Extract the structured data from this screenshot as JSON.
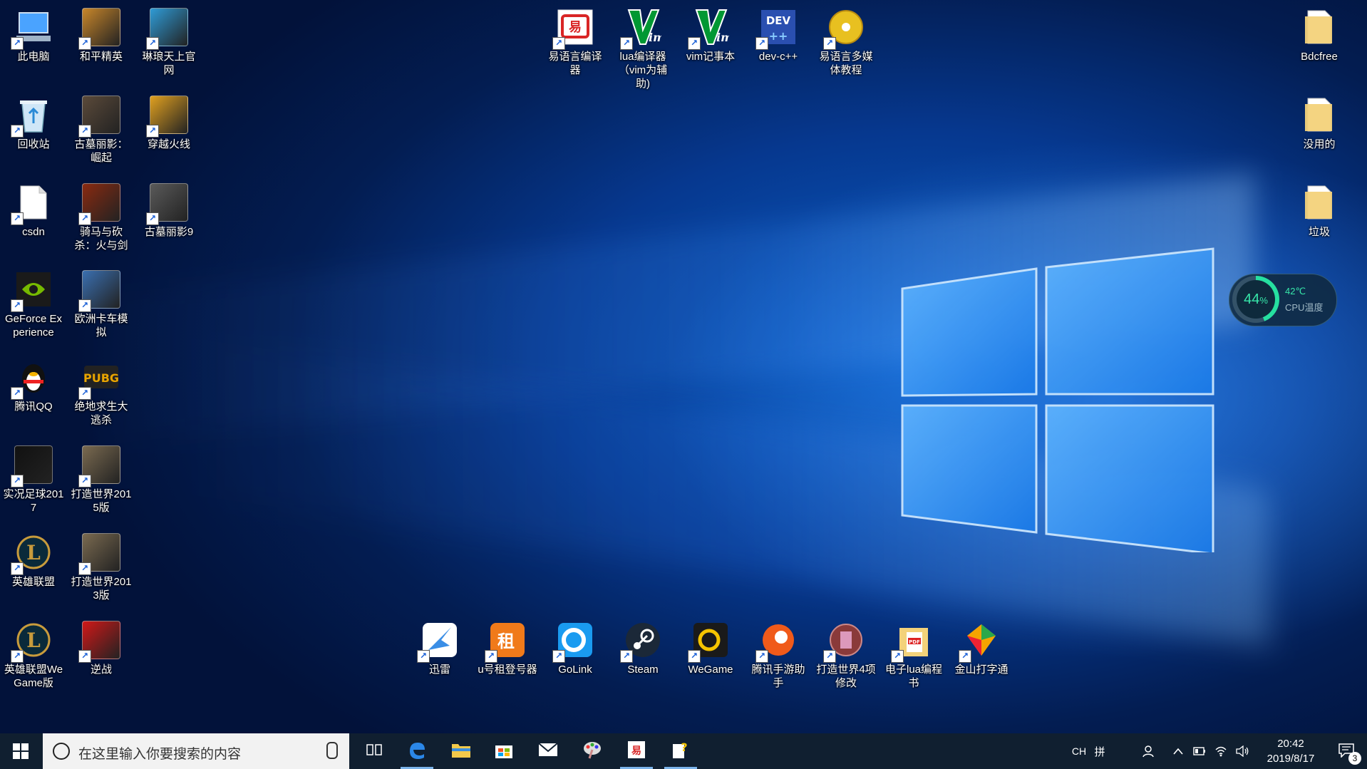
{
  "desktop": {
    "left_icons": [
      {
        "label": "此电脑",
        "icon": "computer-icon",
        "color": "#4aa3ff"
      },
      {
        "label": "和平精英",
        "icon": "game-icon",
        "color": "#c8862a"
      },
      {
        "label": "琳琅天上官网",
        "icon": "game-icon",
        "color": "#2f9bd6"
      },
      {
        "label": "回收站",
        "icon": "recycle-bin-icon",
        "color": "#cfe6f7"
      },
      {
        "label": "古墓丽影：崛起",
        "icon": "game-icon",
        "color": "#5b4a3a"
      },
      {
        "label": "穿越火线",
        "icon": "game-icon",
        "color": "#e0a020"
      },
      {
        "label": "csdn",
        "icon": "file-icon",
        "color": "#ffffff"
      },
      {
        "label": "骑马与砍杀：火与剑",
        "icon": "game-icon",
        "color": "#8a2a10"
      },
      {
        "label": "古墓丽影9",
        "icon": "game-icon",
        "color": "#5a5a5a"
      },
      {
        "label": "GeForce Experience",
        "icon": "nvidia-icon",
        "color": "#76b900"
      },
      {
        "label": "欧洲卡车模拟",
        "icon": "game-icon",
        "color": "#3a6fb0"
      },
      {
        "label": "腾讯QQ",
        "icon": "qq-penguin-icon",
        "color": "#111111"
      },
      {
        "label": "绝地求生大逃杀",
        "icon": "pubg-icon",
        "color": "#e8a400"
      },
      {
        "label": "实况足球2017",
        "icon": "game-icon",
        "color": "#111111"
      },
      {
        "label": "打造世界2015版",
        "icon": "game-icon",
        "color": "#7a6a50"
      },
      {
        "label": "英雄联盟",
        "icon": "lol-icon",
        "color": "#c89b3c"
      },
      {
        "label": "打造世界2013版",
        "icon": "game-icon",
        "color": "#7a6a50"
      },
      {
        "label": "英雄联盟WeGame版",
        "icon": "lol-icon",
        "color": "#c89b3c"
      },
      {
        "label": "逆战",
        "icon": "game-icon",
        "color": "#d01818"
      }
    ],
    "top_icons": [
      {
        "label": "易语言编译器",
        "icon": "eyuyan-icon",
        "color": "#d92525"
      },
      {
        "label": "lua编译器（vim为辅助)",
        "icon": "vim-icon",
        "color": "#019833"
      },
      {
        "label": "vim记事本",
        "icon": "vim-icon",
        "color": "#019833"
      },
      {
        "label": "dev-c++",
        "icon": "devcpp-icon",
        "color": "#2a4fb0"
      },
      {
        "label": "易语言多媒体教程",
        "icon": "cd-icon",
        "color": "#e8c020"
      }
    ],
    "right_icons": [
      {
        "label": "Bdcfree",
        "icon": "folder-icon",
        "color": "#f3d27a"
      },
      {
        "label": "没用的",
        "icon": "folder-icon",
        "color": "#f3d27a"
      },
      {
        "label": "垃圾",
        "icon": "folder-icon",
        "color": "#f3d27a"
      }
    ],
    "bottom_icons": [
      {
        "label": "迅雷",
        "icon": "xunlei-icon",
        "color": "#3a8ee6"
      },
      {
        "label": "u号租登号器",
        "icon": "uhaozu-icon",
        "color": "#f07a1a"
      },
      {
        "label": "GoLink",
        "icon": "golink-icon",
        "color": "#1a9bf0"
      },
      {
        "label": "Steam",
        "icon": "steam-icon",
        "color": "#1b2838"
      },
      {
        "label": "WeGame",
        "icon": "wegame-icon",
        "color": "#1a1a1a"
      },
      {
        "label": "腾讯手游助手",
        "icon": "tencent-mobile-icon",
        "color": "#f05a1a"
      },
      {
        "label": "打造世界4项修改",
        "icon": "trainer-icon",
        "color": "#8a3a3a"
      },
      {
        "label": "电子lua编程书",
        "icon": "pdf-icon",
        "color": "#f3d27a"
      },
      {
        "label": "金山打字通",
        "icon": "typing-icon",
        "color": "#2aa84a"
      }
    ]
  },
  "cpu_widget": {
    "percent": "44",
    "percent_unit": "%",
    "temperature": "42℃",
    "label": "CPU温度"
  },
  "taskbar": {
    "search_placeholder": "在这里输入你要搜索的内容",
    "pinned": [
      {
        "icon": "task-view-icon",
        "active": false
      },
      {
        "icon": "edge-icon",
        "active": true
      },
      {
        "icon": "file-explorer-icon",
        "active": false
      },
      {
        "icon": "store-icon",
        "active": false
      },
      {
        "icon": "mail-icon",
        "active": false
      },
      {
        "icon": "paint-icon",
        "active": false
      },
      {
        "icon": "eyuyan-icon",
        "active": true
      },
      {
        "icon": "help-tool-icon",
        "active": true
      }
    ],
    "ime": "CH",
    "ime_mode": "拼",
    "time": "20:42",
    "date": "2019/8/17",
    "notifications": "3"
  }
}
